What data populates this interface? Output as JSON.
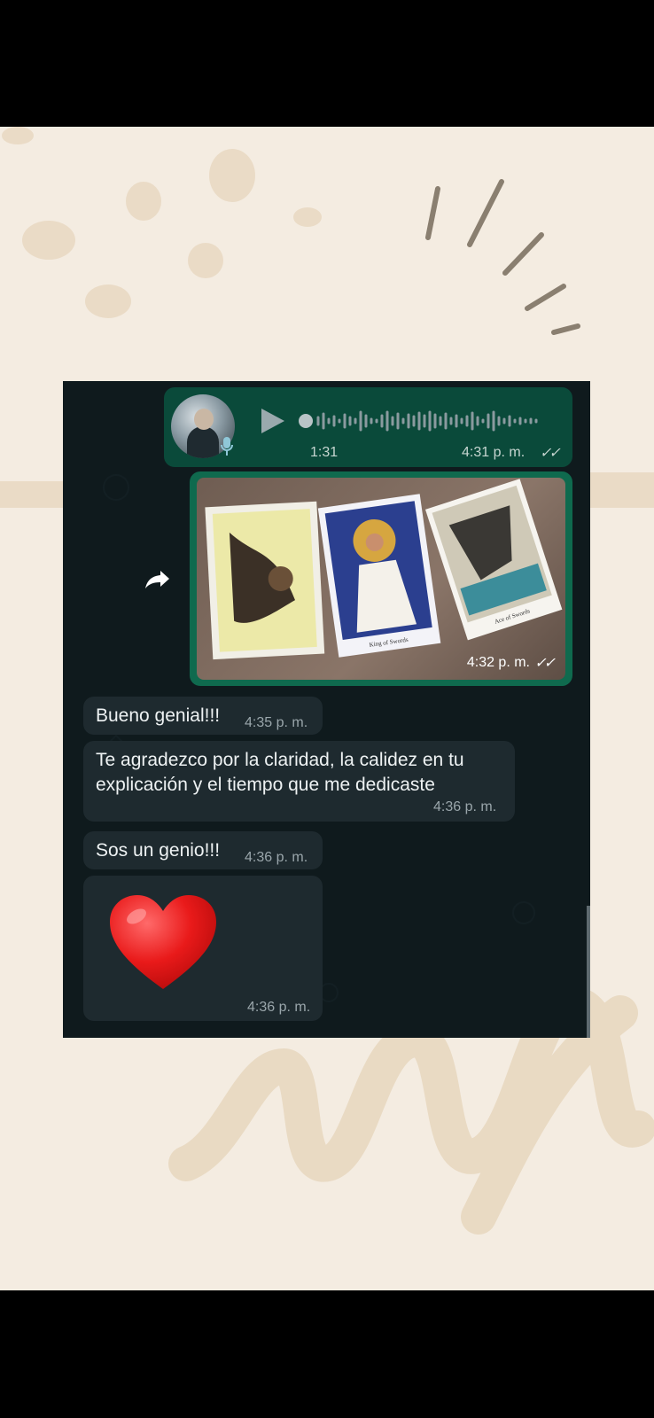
{
  "voice_message": {
    "duration": "1:31",
    "time": "4:31 p. m.",
    "status_icon": "double-check-icon",
    "play_icon": "play-icon",
    "mic_icon": "microphone-icon"
  },
  "image_message": {
    "time": "4:32 p. m.",
    "status_icon": "double-check-icon",
    "forward_icon": "forward-arrow-icon",
    "card_captions": [
      "King of Swords",
      "Ace of Swords"
    ]
  },
  "messages": [
    {
      "text": "Bueno genial!!!",
      "time": "4:35 p. m."
    },
    {
      "text_line1": "Te agradezco por la claridad, la calidez en tu",
      "text_line2": "explicación y el tiempo que me dedicaste",
      "time": "4:36 p. m."
    },
    {
      "text": "Sos un genio!!!",
      "time": "4:36 p. m."
    },
    {
      "emoji": "❤",
      "time": "4:36 p. m."
    }
  ],
  "colors": {
    "background": "#f4ece1",
    "chat_bg": "#0f1a1d",
    "outgoing_bubble": "#0a4a3a",
    "incoming_bubble": "#1e2a2f",
    "accent_green": "#1a7a5a"
  }
}
